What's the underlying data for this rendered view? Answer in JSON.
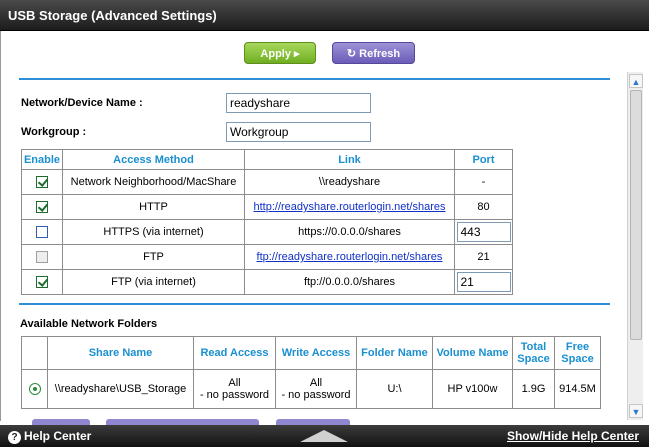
{
  "window": {
    "title": "USB Storage (Advanced Settings)"
  },
  "toolbar": {
    "apply_label": "Apply ▸",
    "refresh_label": "↻ Refresh"
  },
  "form": {
    "device_name_label": "Network/Device Name :",
    "device_name_value": "readyshare",
    "workgroup_label": "Workgroup :",
    "workgroup_value": "Workgroup"
  },
  "access": {
    "headers": {
      "enable": "Enable",
      "method": "Access Method",
      "link": "Link",
      "port": "Port"
    },
    "rows": [
      {
        "enabled": true,
        "method": "Network Neighborhood/MacShare",
        "link": "\\\\readyshare",
        "link_is_url": false,
        "port": "-",
        "port_editable": false
      },
      {
        "enabled": true,
        "method": "HTTP",
        "link": "http://readyshare.routerlogin.net/shares",
        "link_is_url": true,
        "port": "80",
        "port_editable": false
      },
      {
        "enabled": false,
        "method": "HTTPS (via internet)",
        "link": "https://0.0.0.0/shares",
        "link_is_url": false,
        "port": "443",
        "port_editable": true
      },
      {
        "enabled": false,
        "method": "FTP",
        "link": "ftp://readyshare.routerlogin.net/shares",
        "link_is_url": true,
        "port": "21",
        "port_editable": false
      },
      {
        "enabled": true,
        "method": "FTP (via internet)",
        "link": "ftp://0.0.0.0/shares",
        "link_is_url": false,
        "port": "21",
        "port_editable": true
      }
    ]
  },
  "folders": {
    "section_title": "Available Network Folders",
    "headers": {
      "share_name": "Share Name",
      "read_access": "Read Access",
      "write_access": "Write Access",
      "folder_name": "Folder Name",
      "volume_name": "Volume Name",
      "total_space": "Total Space",
      "free_space": "Free Space"
    },
    "rows": [
      {
        "selected": true,
        "share_name": "\\\\readyshare\\USB_Storage",
        "read_access": "All\n- no password",
        "write_access": "All\n- no password",
        "folder_name": "U:\\",
        "volume_name": "HP v100w",
        "total_space": "1.9G",
        "free_space": "914.5M"
      }
    ]
  },
  "footer": {
    "help_label": "Help Center",
    "toggle_label": "Show/Hide Help Center"
  },
  "colors": {
    "accent_blue": "#1a8fd0",
    "apply_green": "#6fae21",
    "refresh_purple": "#6a5cb8",
    "rule_blue": "#2e8fd6"
  },
  "icons": {
    "help": "question-circle-icon",
    "scroll_up": "chevron-up-icon",
    "scroll_down": "chevron-down-icon",
    "panel_toggle": "triangle-up-icon"
  }
}
